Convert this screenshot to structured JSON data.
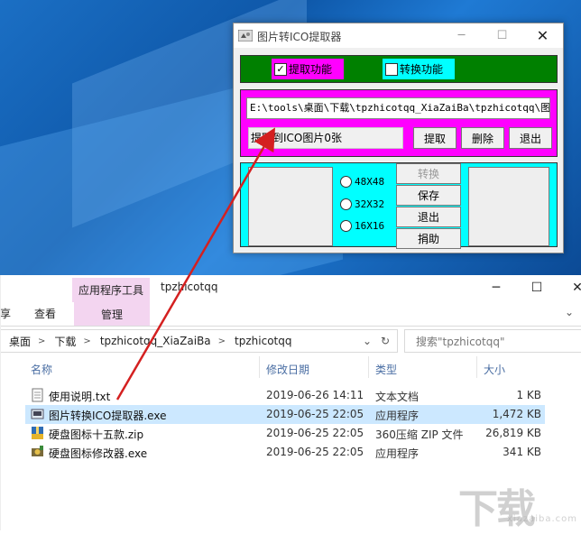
{
  "explorer": {
    "context_tab": "应用程序工具",
    "window_title": "tpzhicotqq",
    "tabs": [
      "享",
      "查看",
      "管理"
    ],
    "address": [
      "桌面",
      "下载",
      "tpzhicotqq_XiaZaiBa",
      "tpzhicotqq"
    ],
    "search_placeholder": "搜索\"tpzhicotqq\"",
    "columns": [
      "名称",
      "修改日期",
      "类型",
      "大小"
    ],
    "files": [
      {
        "name": "使用说明.txt",
        "date": "2019-06-26 14:11",
        "type": "文本文档",
        "size": "1 KB",
        "icon": "text-file-icon"
      },
      {
        "name": "图片转换ICO提取器.exe",
        "date": "2019-06-25 22:05",
        "type": "应用程序",
        "size": "1,472 KB",
        "icon": "exe-icon",
        "selected": true
      },
      {
        "name": "硬盘图标十五款.zip",
        "date": "2019-06-25 22:05",
        "type": "360压缩 ZIP 文件",
        "size": "26,819 KB",
        "icon": "zip-icon"
      },
      {
        "name": "硬盘图标修改器.exe",
        "date": "2019-06-25 22:05",
        "type": "应用程序",
        "size": "341 KB",
        "icon": "exe-icon"
      }
    ]
  },
  "app": {
    "title": "图片转ICO提取器",
    "extract_label": "提取功能",
    "extract_checked": true,
    "convert_label": "转换功能",
    "convert_checked": false,
    "path_value": "E:\\tools\\桌面\\下载\\tpzhicotqq_XiaZaiBa\\tpzhicotqq\\图片转",
    "status": "提取到ICO图片0张",
    "buttons": {
      "extract": "提取",
      "delete": "删除",
      "exit": "退出"
    },
    "sizes": [
      "48X48",
      "32X32",
      "16X16"
    ],
    "actions": {
      "convert": "转换",
      "save": "保存",
      "exit": "退出",
      "donate": "捐助"
    }
  },
  "colors": {
    "green": "#008000",
    "magenta": "#ff00ff",
    "cyan": "#00ffff",
    "selection": "#cce8ff",
    "context_tab": "#f3d5f0"
  }
}
